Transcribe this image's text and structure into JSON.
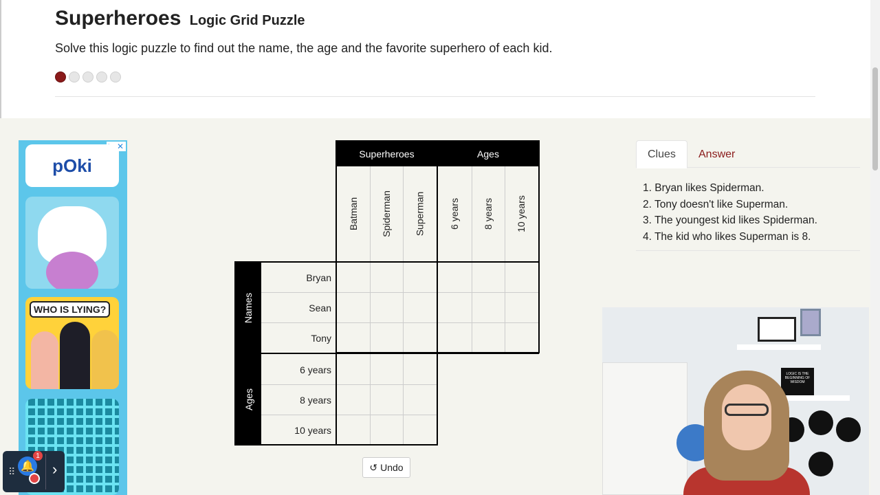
{
  "header": {
    "title": "Superheroes",
    "subtitle": "Logic Grid Puzzle",
    "description": "Solve this logic puzzle to find out the name, the age and the favorite superhero of each kid.",
    "difficulty_level": 1,
    "difficulty_max": 5
  },
  "ad": {
    "close_label": "✕",
    "adchoices_label": "▷",
    "poki_label": "pOki",
    "lying_label": "WHO IS LYING?"
  },
  "puzzle": {
    "col_groups": [
      {
        "label": "Superheroes",
        "items": [
          "Batman",
          "Spiderman",
          "Superman"
        ]
      },
      {
        "label": "Ages",
        "items": [
          "6 years",
          "8 years",
          "10 years"
        ]
      }
    ],
    "row_groups": [
      {
        "label": "Names",
        "items": [
          "Bryan",
          "Sean",
          "Tony"
        ]
      },
      {
        "label": "Ages",
        "items": [
          "6 years",
          "8 years",
          "10 years"
        ]
      }
    ]
  },
  "undo_label": "Undo",
  "tabs": {
    "clues": "Clues",
    "answer": "Answer"
  },
  "clues": [
    "1. Bryan likes Spiderman.",
    "2. Tony doesn't like Superman.",
    "3. The youngest kid likes Spiderman.",
    "4. The kid who likes Superman is 8."
  ],
  "video": {
    "sign_text": "LOGIC IS THE BEGINNING OF WISDOM"
  },
  "notification": {
    "badge_count": "1"
  },
  "colors": {
    "accent": "#8a1a1a",
    "grid_header": "#000000",
    "background": "#f4f4ee"
  }
}
